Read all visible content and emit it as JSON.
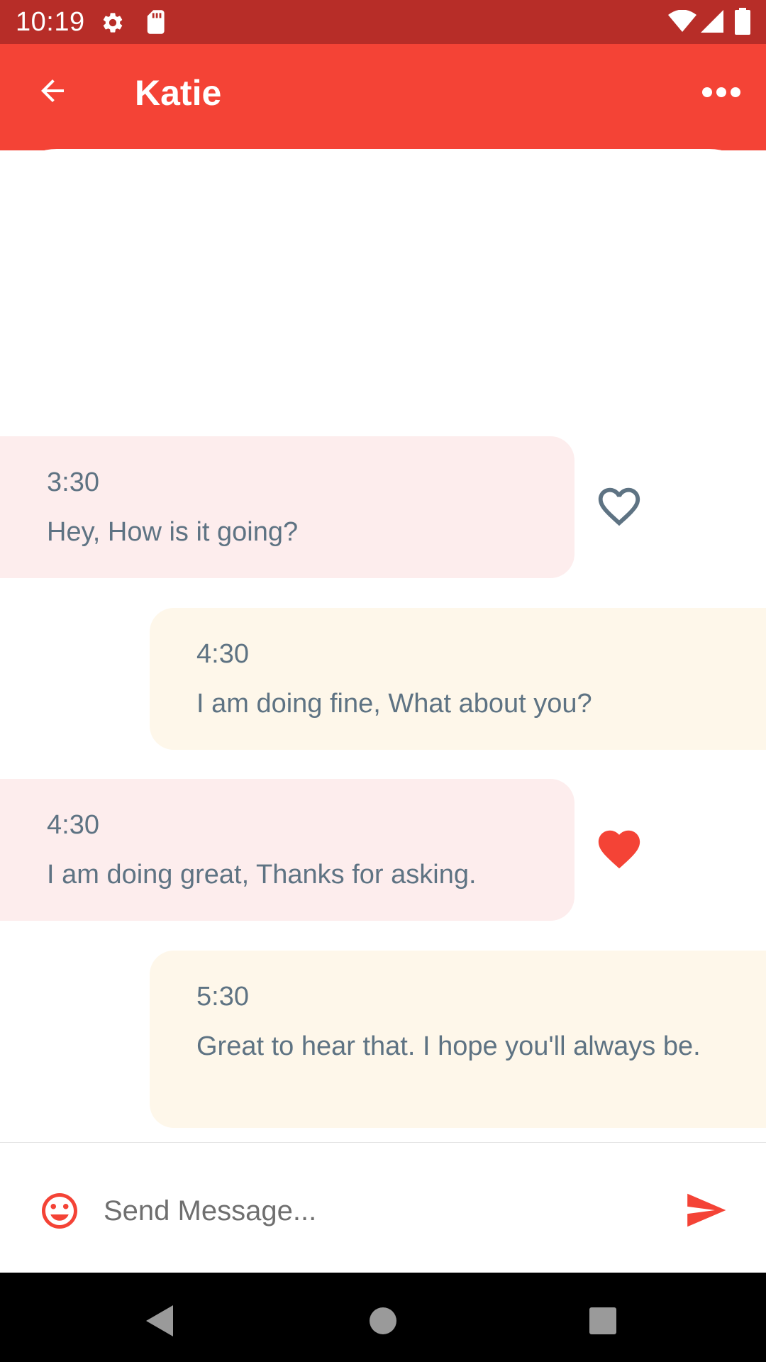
{
  "status_bar": {
    "time": "10:19",
    "icons": [
      "settings-gear-icon",
      "sd-card-icon",
      "wifi-icon",
      "cell-signal-icon",
      "battery-icon"
    ]
  },
  "app_bar": {
    "title": "Katie",
    "back_icon": "arrow-back-icon",
    "more_icon": "more-horizontal-icon",
    "color": "#F44336",
    "status_color": "#B72D28"
  },
  "messages": [
    {
      "direction": "received",
      "time": "3:30",
      "text": "Hey, How is it going?",
      "liked": false
    },
    {
      "direction": "sent",
      "time": "4:30",
      "text": "I am doing fine, What about you?"
    },
    {
      "direction": "received",
      "time": "4:30",
      "text": "I am doing great, Thanks for asking.",
      "liked": true
    },
    {
      "direction": "sent",
      "time": "5:30",
      "text": "Great to hear that. I hope you'll always be."
    }
  ],
  "composer": {
    "placeholder": "Send Message...",
    "value": "",
    "emoji_icon": "emoji-smile-icon",
    "send_icon": "send-icon"
  },
  "colors": {
    "received_bubble": "#FDEDED",
    "sent_bubble": "#FEF7EA",
    "message_text": "#5E7383",
    "accent": "#F44336"
  },
  "nav_bar": {
    "icons": [
      "nav-back-icon",
      "nav-home-icon",
      "nav-recents-icon"
    ]
  }
}
